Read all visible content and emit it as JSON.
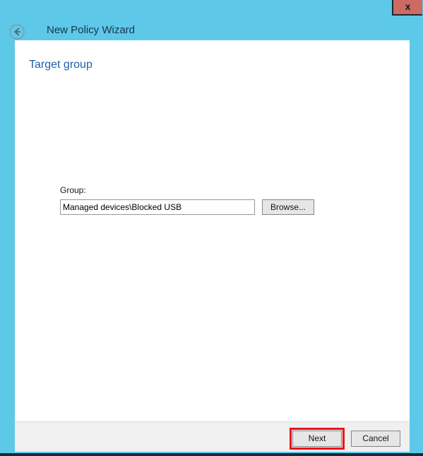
{
  "window": {
    "title": "New Policy Wizard",
    "close_label": "x",
    "back_icon": "back-arrow-circle-icon",
    "accent_color": "#5ec8e8",
    "close_button_color": "#cc6a63"
  },
  "page": {
    "heading": "Target group",
    "heading_color": "#1f5fa8"
  },
  "form": {
    "group_label": "Group:",
    "group_value": "Managed devices\\Blocked USB",
    "group_placeholder": "",
    "browse_label": "Browse..."
  },
  "footer": {
    "next_label": "Next",
    "cancel_label": "Cancel",
    "highlight_color": "#e8141c"
  }
}
